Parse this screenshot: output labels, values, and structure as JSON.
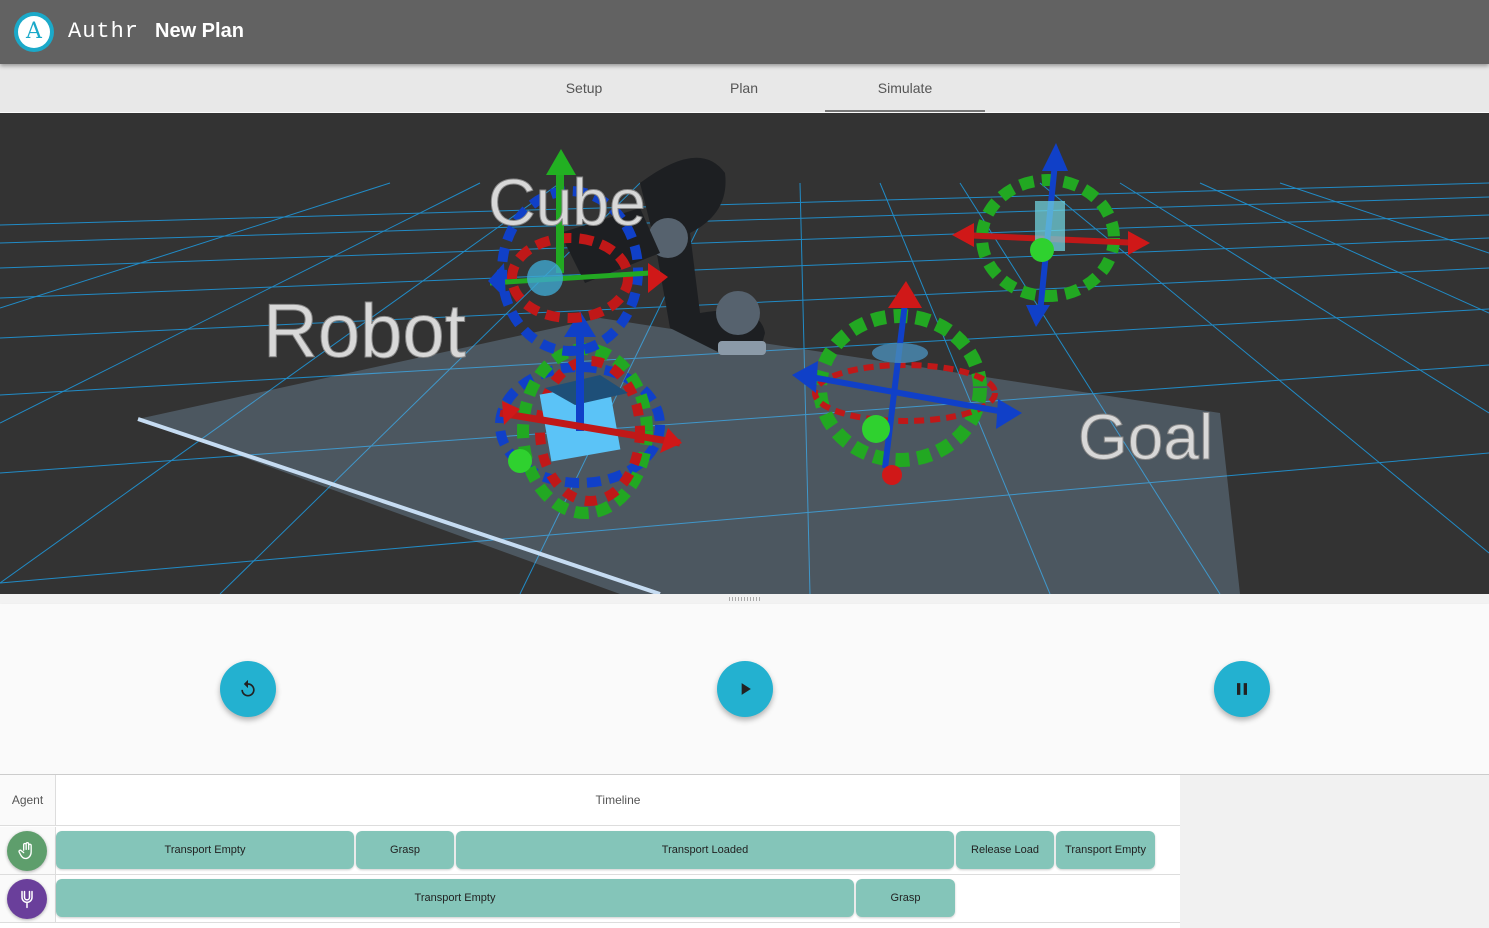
{
  "header": {
    "logo_letter": "A",
    "brand": "Authr",
    "title": "New Plan"
  },
  "tabs": [
    {
      "label": "Setup",
      "active": false
    },
    {
      "label": "Plan",
      "active": false
    },
    {
      "label": "Simulate",
      "active": true
    }
  ],
  "scene": {
    "labels": {
      "cube": "Cube",
      "robot": "Robot",
      "goal": "Goal"
    }
  },
  "controls": {
    "reset_icon": "replay-icon",
    "play_icon": "play-icon",
    "pause_icon": "pause-icon",
    "accent_color": "#23b1d0"
  },
  "timeline": {
    "agent_header": "Agent",
    "timeline_header": "Timeline",
    "rows": [
      {
        "agent_icon": "hand-icon",
        "agent_color": "#5e9e6c",
        "blocks": [
          "Transport Empty",
          "Grasp",
          "Transport Loaded",
          "Release Load",
          "Transport Empty"
        ]
      },
      {
        "agent_icon": "gripper-icon",
        "agent_color": "#6a3f9b",
        "blocks": [
          "Transport Empty",
          "Grasp"
        ]
      }
    ]
  }
}
